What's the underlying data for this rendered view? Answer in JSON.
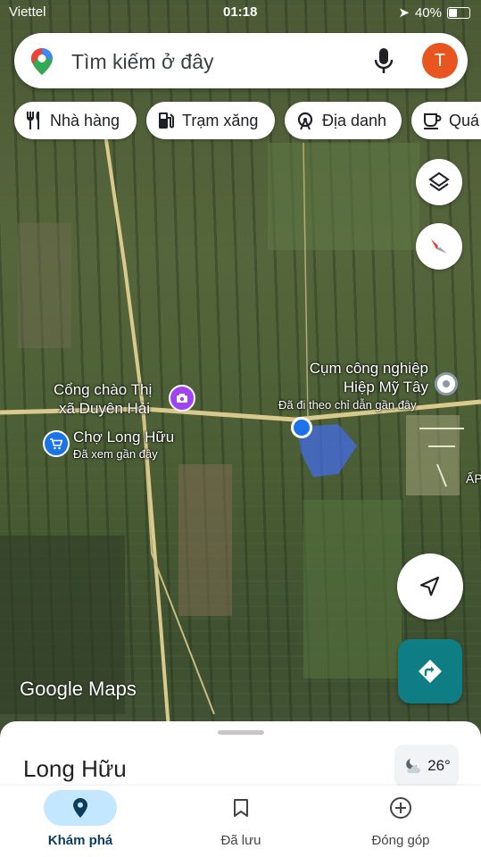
{
  "status_bar": {
    "carrier": "Viettel",
    "time": "01:18",
    "battery": "40%"
  },
  "search": {
    "placeholder": "Tìm kiếm ở đây",
    "avatar_letter": "T"
  },
  "chips": [
    {
      "label": "Nhà hàng",
      "icon": "restaurant-icon"
    },
    {
      "label": "Trạm xăng",
      "icon": "gas-station-icon"
    },
    {
      "label": "Địa danh",
      "icon": "landmark-icon"
    },
    {
      "label": "Quá",
      "icon": "coffee-icon"
    }
  ],
  "map_labels": {
    "gate_title_line1": "Cổng chào Thị",
    "gate_title_line2": "xã Duyên Hải",
    "market_title": "Chợ Long Hữu",
    "market_sub": "Đã xem gần đây",
    "industrial_line1": "Cụm công nghiệp",
    "industrial_line2": "Hiệp Mỹ Tây",
    "industrial_sub": "Đã đi theo chỉ dẫn gần đây",
    "edge_label": "ẤP"
  },
  "logo": "Google Maps",
  "sheet": {
    "title": "Long Hữu",
    "temperature": "26°"
  },
  "nav": [
    {
      "label": "Khám phá",
      "icon": "explore-pin-icon",
      "active": true
    },
    {
      "label": "Đã lưu",
      "icon": "bookmark-icon",
      "active": false
    },
    {
      "label": "Đóng góp",
      "icon": "add-circle-icon",
      "active": false
    }
  ],
  "colors": {
    "accent": "#1a73e8",
    "avatar": "#e8551f",
    "directions": "#0e7e84",
    "active_nav": "#c2e7ff"
  }
}
